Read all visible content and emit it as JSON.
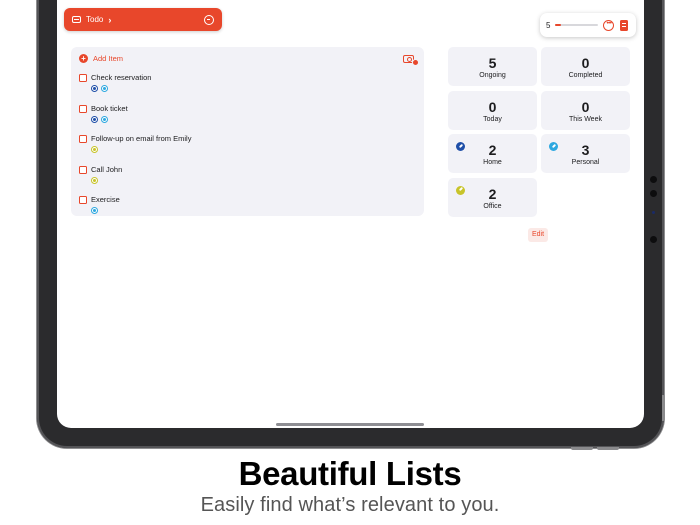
{
  "app": {
    "list_title": "Todo"
  },
  "top_control": {
    "count": "5",
    "slider_level": 0.12
  },
  "list": {
    "add_label": "Add Item",
    "items": [
      {
        "label": "Check reservation",
        "tags": [
          "home",
          "personal"
        ]
      },
      {
        "label": "Book ticket",
        "tags": [
          "home",
          "personal"
        ]
      },
      {
        "label": "Follow-up on email from Emily",
        "tags": [
          "office"
        ]
      },
      {
        "label": "Call John",
        "tags": [
          "office"
        ]
      },
      {
        "label": "Exercise",
        "tags": [
          "personal"
        ]
      }
    ]
  },
  "stats": [
    {
      "count": "5",
      "label": "Ongoing"
    },
    {
      "count": "0",
      "label": "Completed"
    },
    {
      "count": "0",
      "label": "Today"
    },
    {
      "count": "0",
      "label": "This Week"
    },
    {
      "count": "2",
      "label": "Home",
      "icon": "home-tag-icon",
      "color": "#1f4fa8"
    },
    {
      "count": "3",
      "label": "Personal",
      "icon": "personal-tag-icon",
      "color": "#2ea8e0"
    },
    {
      "count": "2",
      "label": "Office",
      "icon": "office-tag-icon",
      "color": "#c8c42a"
    }
  ],
  "edit_label": "Edit",
  "tag_colors": {
    "home": "#1f4fa8",
    "personal": "#2ea8e0",
    "office": "#c8c42a"
  },
  "accent_color": "#e8472b",
  "caption": {
    "title": "Beautiful Lists",
    "subtitle": "Easily find what’s relevant to you."
  }
}
